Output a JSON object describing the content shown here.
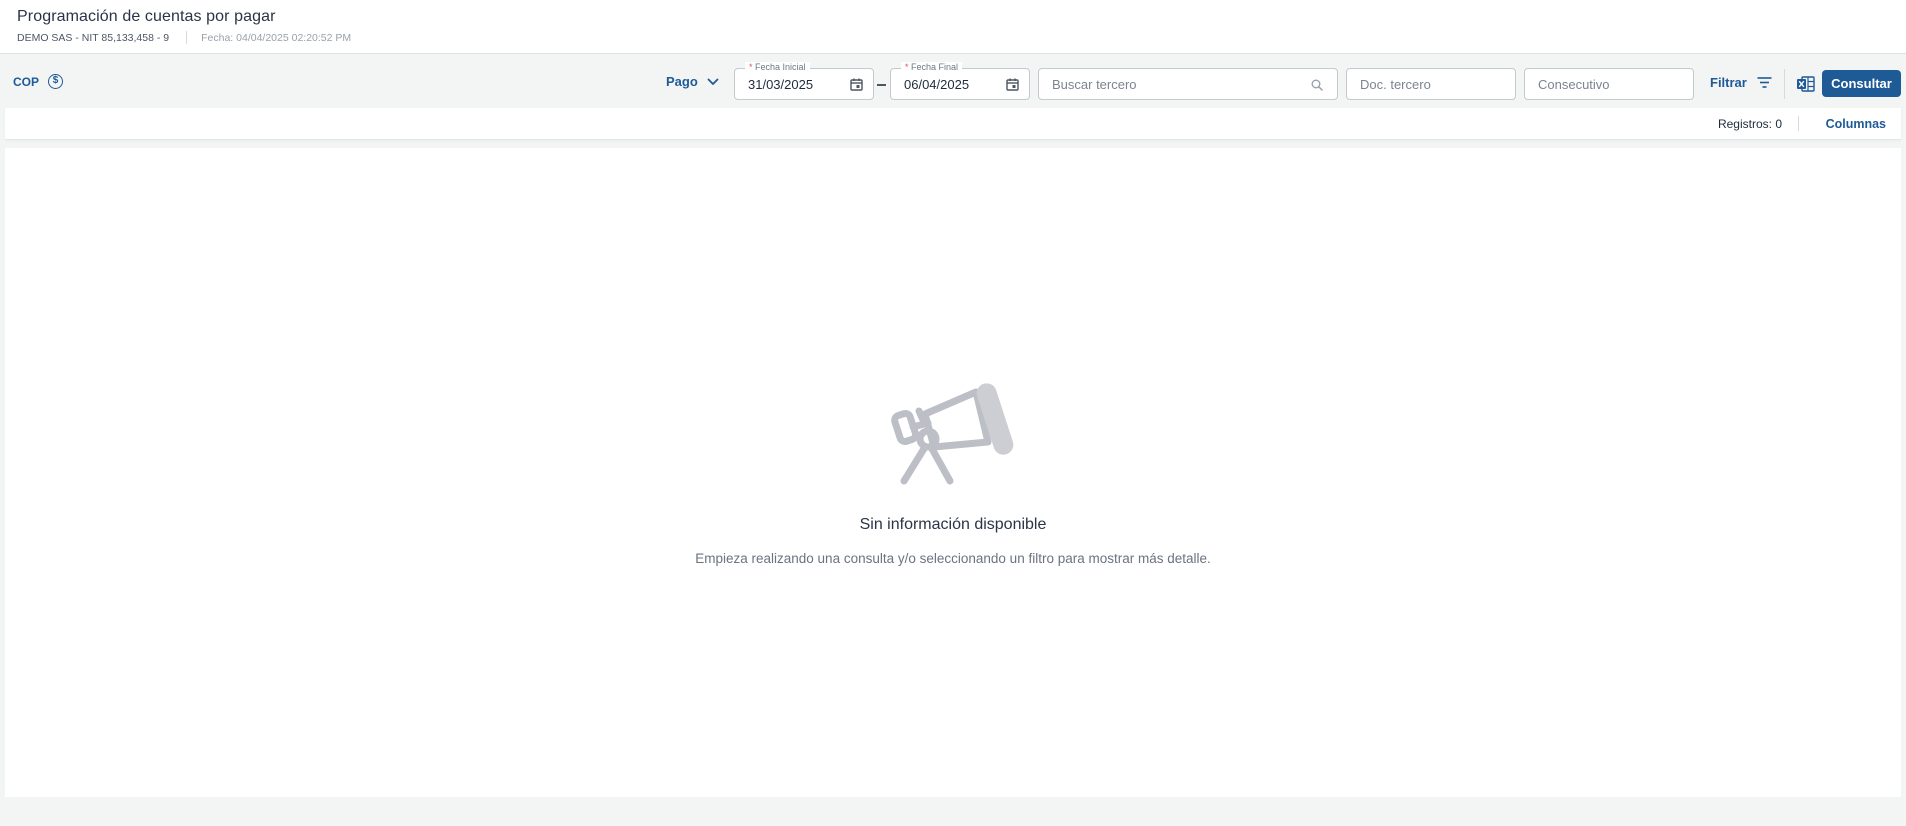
{
  "header": {
    "title": "Programación de cuentas por pagar",
    "company": "DEMO SAS - NIT 85,133,458 - 9",
    "date": "Fecha: 04/04/2025 02:20:52 PM"
  },
  "toolbar": {
    "currency": "COP",
    "currency_icon": "dollar-circle-icon",
    "mode": "Pago",
    "start_date": {
      "label": "Fecha Inicial",
      "required_mark": "*",
      "value": "31/03/2025"
    },
    "end_date": {
      "label": "Fecha Final",
      "required_mark": "*",
      "value": "06/04/2025"
    },
    "search_placeholder": "Buscar tercero",
    "doc_placeholder": "Doc. tercero",
    "consecutive_placeholder": "Consecutivo",
    "filter_label": "Filtrar",
    "consult_label": "Consultar"
  },
  "records": {
    "count_label": "Registros: 0",
    "columns_label": "Columnas"
  },
  "empty_state": {
    "icon": "telescope-icon",
    "title": "Sin información disponible",
    "subtitle": "Empieza realizando una consulta y/o seleccionando un filtro para mostrar más detalle."
  },
  "colors": {
    "accent": "#1d5a96",
    "background": "#f3f4f4",
    "illustration": "#bcc0c6"
  }
}
